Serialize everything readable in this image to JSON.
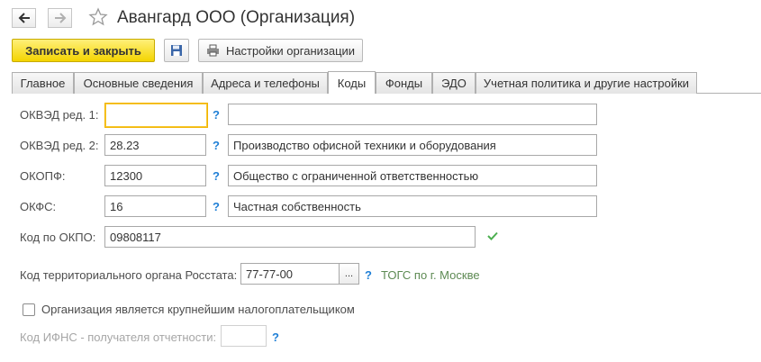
{
  "window": {
    "title": "Авангард ООО (Организация)"
  },
  "toolbar": {
    "save_close_label": "Записать и закрыть",
    "org_settings_label": "Настройки организации"
  },
  "tabs": [
    {
      "label": "Главное"
    },
    {
      "label": "Основные сведения"
    },
    {
      "label": "Адреса и телефоны"
    },
    {
      "label": "Коды"
    },
    {
      "label": "Фонды"
    },
    {
      "label": "ЭДО"
    },
    {
      "label": "Учетная политика и другие настройки"
    }
  ],
  "form": {
    "okved1": {
      "label": "ОКВЭД ред. 1:",
      "code": "",
      "description": ""
    },
    "okved2": {
      "label": "ОКВЭД ред. 2:",
      "code": "28.23",
      "description": "Производство офисной техники и оборудования"
    },
    "okopf": {
      "label": "ОКОПФ:",
      "code": "12300",
      "description": "Общество с ограниченной ответственностью"
    },
    "okfs": {
      "label": "ОКФС:",
      "code": "16",
      "description": "Частная собственность"
    },
    "okpo": {
      "label": "Код по ОКПО:",
      "code": "09808117"
    },
    "rosstat": {
      "label": "Код территориального органа Росстата:",
      "code": "77-77-00",
      "select_button": "...",
      "hint": "ТОГС по г. Москве"
    },
    "largest_taxpayer": {
      "label": "Организация является крупнейшим налогоплательщиком",
      "checked": false
    },
    "ifns": {
      "label": "Код ИФНС - получателя отчетности:",
      "code": ""
    },
    "help_mark": "?"
  },
  "colors": {
    "primary_button": "#f4d400",
    "focus_border": "#f2b300",
    "help_mark": "#1f7fd6",
    "hint_text": "#5d8a53",
    "check_mark": "#4caf50"
  }
}
